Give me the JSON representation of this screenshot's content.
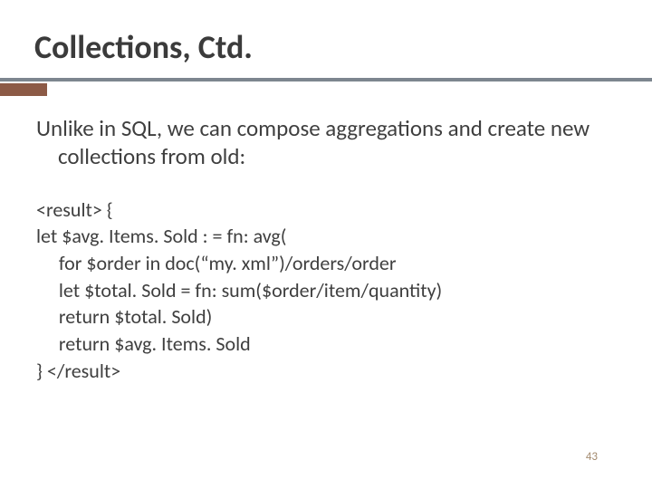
{
  "title": "Collections, Ctd.",
  "lead": "Unlike in SQL, we can compose aggregations and create new collections from old:",
  "code": "<result> {\nlet $avg. Items. Sold : = fn: avg(\n     for $order in doc(“my. xml”)/orders/order\n     let $total. Sold = fn: sum($order/item/quantity)\n     return $total. Sold)\n     return $avg. Items. Sold\n} </result>",
  "page_number": "43"
}
